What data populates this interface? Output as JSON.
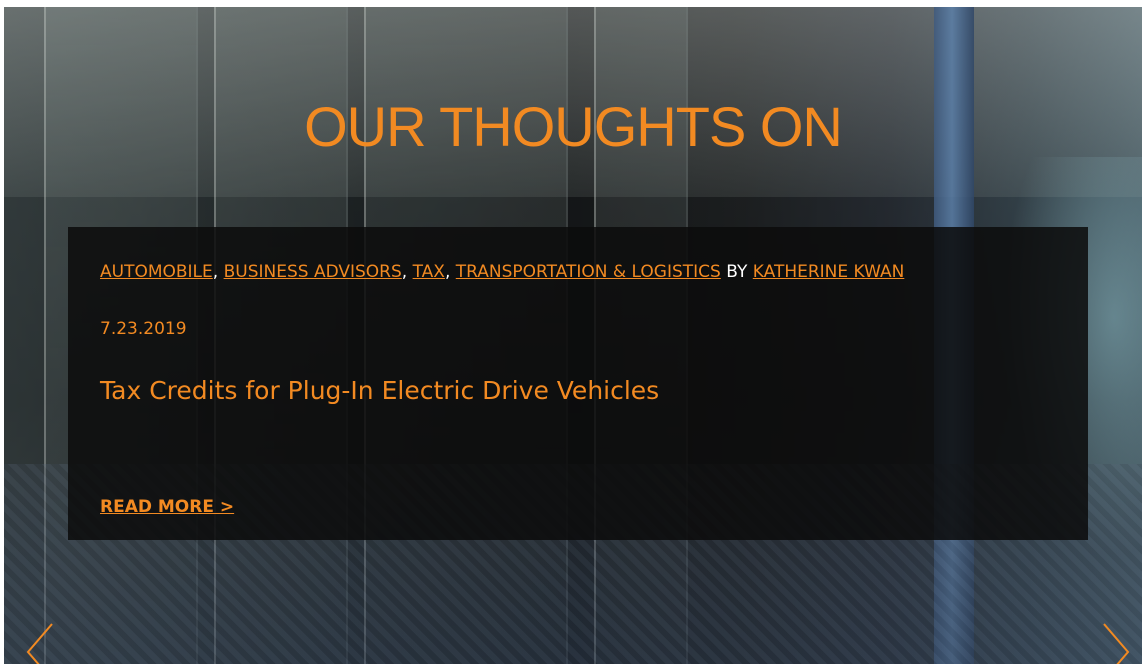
{
  "hero": {
    "title": "OUR THOUGHTS ON"
  },
  "post": {
    "categories": [
      "AUTOMOBILE",
      "BUSINESS ADVISORS",
      "TAX",
      "TRANSPORTATION & LOGISTICS"
    ],
    "by_label": "BY",
    "author": "KATHERINE KWAN",
    "date": "7.23.2019",
    "title": "Tax Credits for Plug-In Electric Drive Vehicles",
    "read_more": "READ MORE >"
  },
  "carousel": {
    "prev_icon": "chevron-left-icon",
    "next_icon": "chevron-right-icon"
  },
  "colors": {
    "accent": "#f28a22",
    "card_bg": "#0c0c0c",
    "text": "#ffffff"
  }
}
